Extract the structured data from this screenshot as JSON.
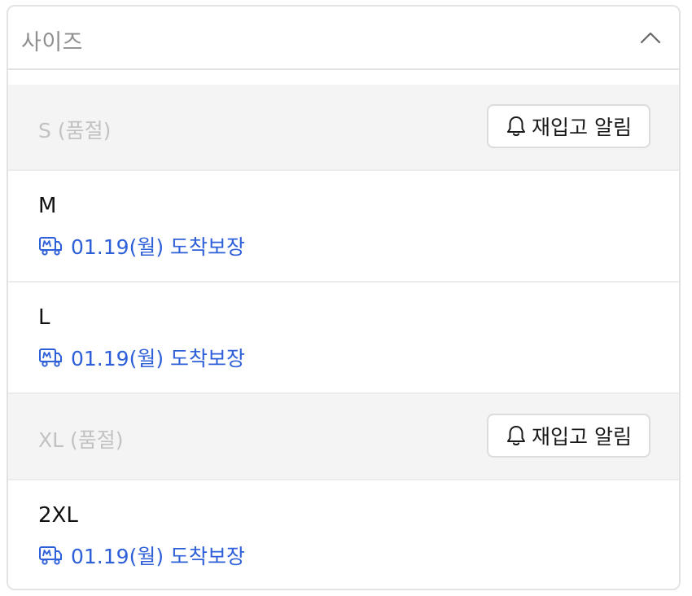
{
  "header": {
    "title": "사이즈",
    "icon": "chevron-up-icon"
  },
  "sizes": [
    {
      "name": "S (품절)",
      "status": "soldout",
      "restock_label": "재입고 알림",
      "icon": "bell-icon"
    },
    {
      "name": "M",
      "status": "available",
      "delivery": "01.19(월) 도착보장",
      "icon": "delivery-truck-icon"
    },
    {
      "name": "L",
      "status": "available",
      "delivery": "01.19(월) 도착보장",
      "icon": "delivery-truck-icon"
    },
    {
      "name": "XL (품절)",
      "status": "soldout",
      "restock_label": "재입고 알림",
      "icon": "bell-icon"
    },
    {
      "name": "2XL",
      "status": "available",
      "delivery": "01.19(월) 도착보장",
      "icon": "delivery-truck-icon"
    }
  ],
  "colors": {
    "delivery_blue": "#2d5fd8",
    "soldout_bg": "#f4f4f4",
    "soldout_text": "#c2c2c2"
  }
}
